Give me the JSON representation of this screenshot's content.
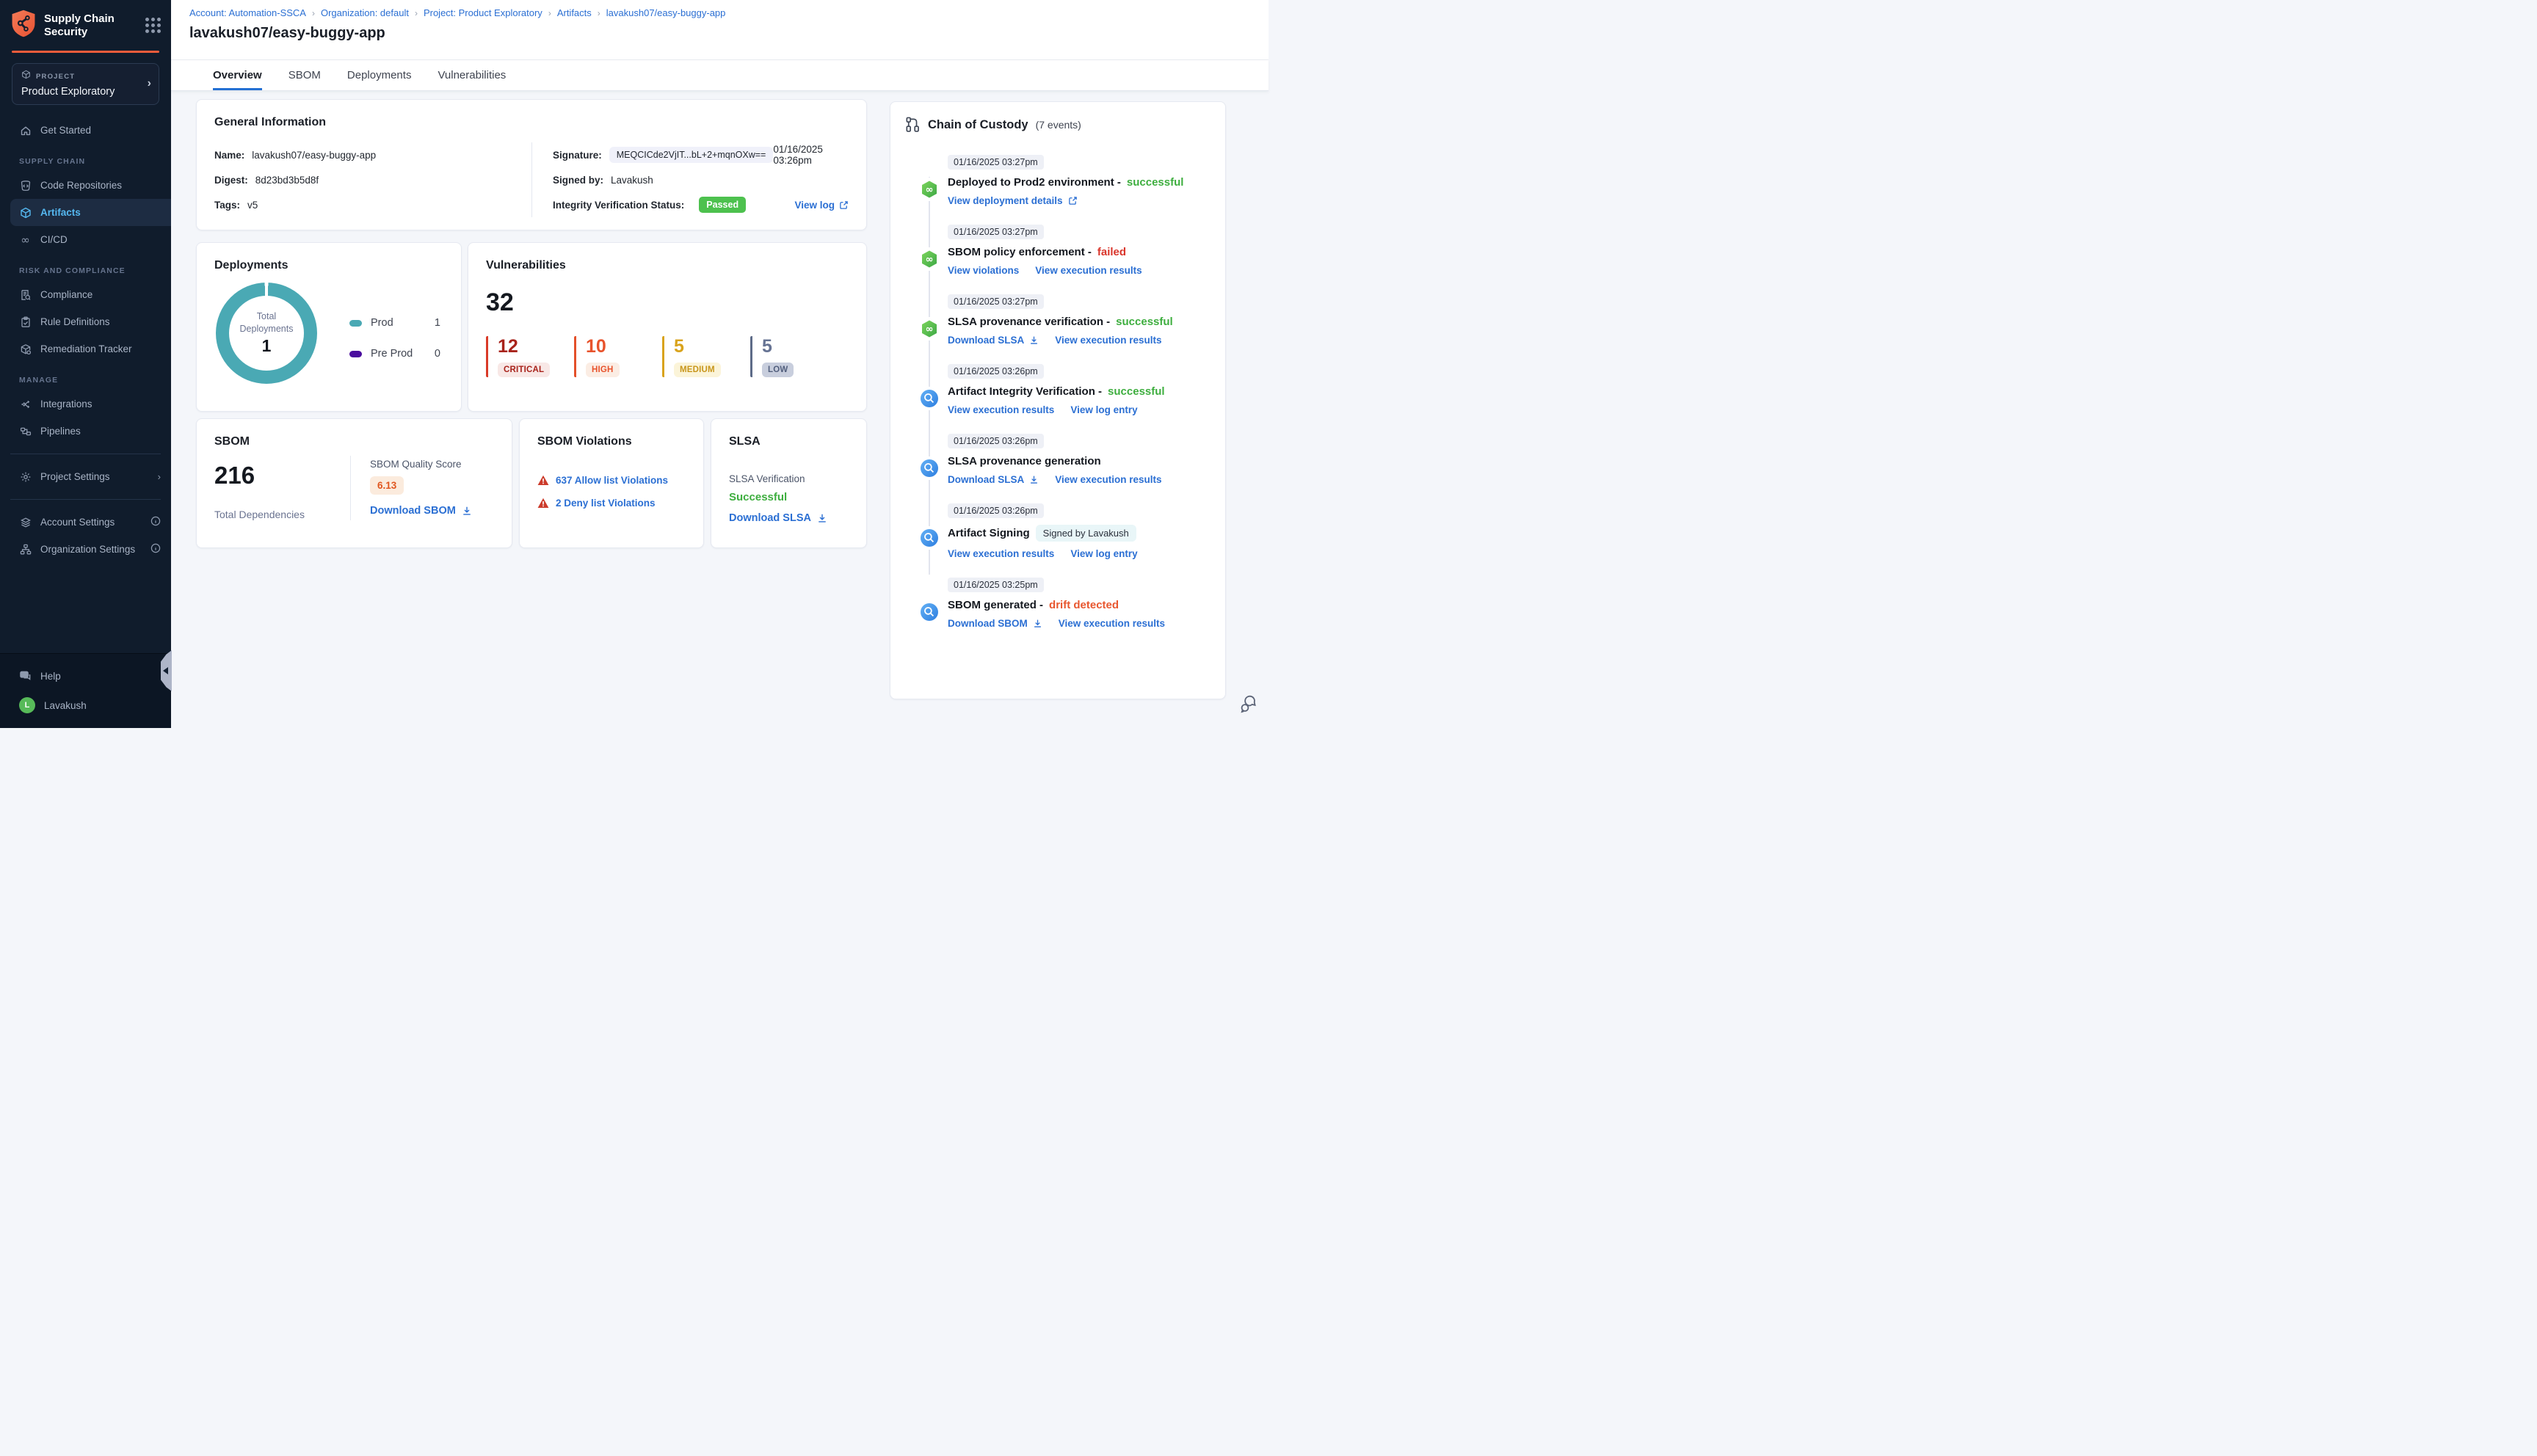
{
  "app": {
    "title": "Supply Chain Security"
  },
  "theme": {
    "sidebar_bg": "#101C2C",
    "brand_orange": "#F25C3B",
    "link_blue": "#2B6FD3",
    "success_green": "#3EAE3F",
    "error_red": "#D9352B",
    "drift_orange": "#E8572F",
    "passed_badge_green": "#4DC14E",
    "active_nav_blue": "#55B8F0"
  },
  "sidebar": {
    "project_label": "PROJECT",
    "project_name": "Product Exploratory",
    "get_started": "Get Started",
    "sections": [
      {
        "label": "SUPPLY CHAIN",
        "items": [
          "Code Repositories",
          "Artifacts",
          "CI/CD"
        ]
      },
      {
        "label": "RISK AND COMPLIANCE",
        "items": [
          "Compliance",
          "Rule Definitions",
          "Remediation Tracker"
        ]
      },
      {
        "label": "MANAGE",
        "items": [
          "Integrations",
          "Pipelines"
        ]
      }
    ],
    "project_settings": "Project Settings",
    "account_settings": "Account Settings",
    "organization_settings": "Organization Settings",
    "help": "Help",
    "user_name": "Lavakush",
    "user_initial": "L"
  },
  "breadcrumb": [
    "Account: Automation-SSCA",
    "Organization: default",
    "Project: Product Exploratory",
    "Artifacts",
    "lavakush07/easy-buggy-app"
  ],
  "page_title": "lavakush07/easy-buggy-app",
  "tabs": [
    "Overview",
    "SBOM",
    "Deployments",
    "Vulnerabilities"
  ],
  "general_info": {
    "title": "General Information",
    "name_label": "Name:",
    "name": "lavakush07/easy-buggy-app",
    "digest_label": "Digest:",
    "digest": "8d23bd3b5d8f",
    "tags_label": "Tags:",
    "tags": "v5",
    "signature_label": "Signature:",
    "signature": "MEQCICde2VjIT...bL+2+mqnOXw==",
    "signature_date": "01/16/2025 03:26pm",
    "signed_by_label": "Signed by:",
    "signed_by": "Lavakush",
    "integrity_label": "Integrity Verification Status:",
    "integrity_status": "Passed",
    "view_log": "View log"
  },
  "deployments": {
    "title": "Deployments",
    "center_label": "Total Deployments",
    "total": "1",
    "legend": [
      {
        "label": "Prod",
        "value": "1",
        "color": "#4AA9B4"
      },
      {
        "label": "Pre Prod",
        "value": "0",
        "color": "#4A0C9E"
      }
    ]
  },
  "vulnerabilities": {
    "title": "Vulnerabilities",
    "total": "32",
    "severities": [
      {
        "label": "CRITICAL",
        "count": "12",
        "color": "#A8231B"
      },
      {
        "label": "HIGH",
        "count": "10",
        "color": "#E8532C"
      },
      {
        "label": "MEDIUM",
        "count": "5",
        "color": "#D9A31C"
      },
      {
        "label": "LOW",
        "count": "5",
        "color": "#667393"
      }
    ]
  },
  "sbom": {
    "title": "SBOM",
    "total": "216",
    "total_label": "Total Dependencies",
    "quality_label": "SBOM Quality Score",
    "quality_score": "6.13",
    "download": "Download SBOM"
  },
  "sbom_violations": {
    "title": "SBOM Violations",
    "allow": "637 Allow list Violations",
    "deny": "2 Deny list Violations"
  },
  "slsa": {
    "title": "SLSA",
    "verification_label": "SLSA Verification",
    "verification_status": "Successful",
    "download": "Download SLSA"
  },
  "chain_of_custody": {
    "title": "Chain of Custody",
    "count": "(7 events)",
    "events": [
      {
        "timestamp": "01/16/2025 03:27pm",
        "title": "Deployed to Prod2 environment -",
        "status": "successful",
        "links": [
          "View deployment details"
        ]
      },
      {
        "timestamp": "01/16/2025 03:27pm",
        "title": "SBOM policy enforcement -",
        "status": "failed",
        "links": [
          "View violations",
          "View execution results"
        ]
      },
      {
        "timestamp": "01/16/2025 03:27pm",
        "title": "SLSA provenance verification -",
        "status": "successful",
        "links": [
          "Download SLSA",
          "View execution results"
        ]
      },
      {
        "timestamp": "01/16/2025 03:26pm",
        "title": "Artifact Integrity Verification -",
        "status": "successful",
        "links": [
          "View execution results",
          "View log entry"
        ]
      },
      {
        "timestamp": "01/16/2025 03:26pm",
        "title": "SLSA provenance generation",
        "status": "",
        "links": [
          "Download SLSA",
          "View execution results"
        ]
      },
      {
        "timestamp": "01/16/2025 03:26pm",
        "title": "Artifact Signing",
        "status": "",
        "badge": "Signed by Lavakush",
        "links": [
          "View execution results",
          "View log entry"
        ]
      },
      {
        "timestamp": "01/16/2025 03:25pm",
        "title": "SBOM generated -",
        "status": "drift detected",
        "links": [
          "Download SBOM",
          "View execution results"
        ]
      }
    ]
  }
}
